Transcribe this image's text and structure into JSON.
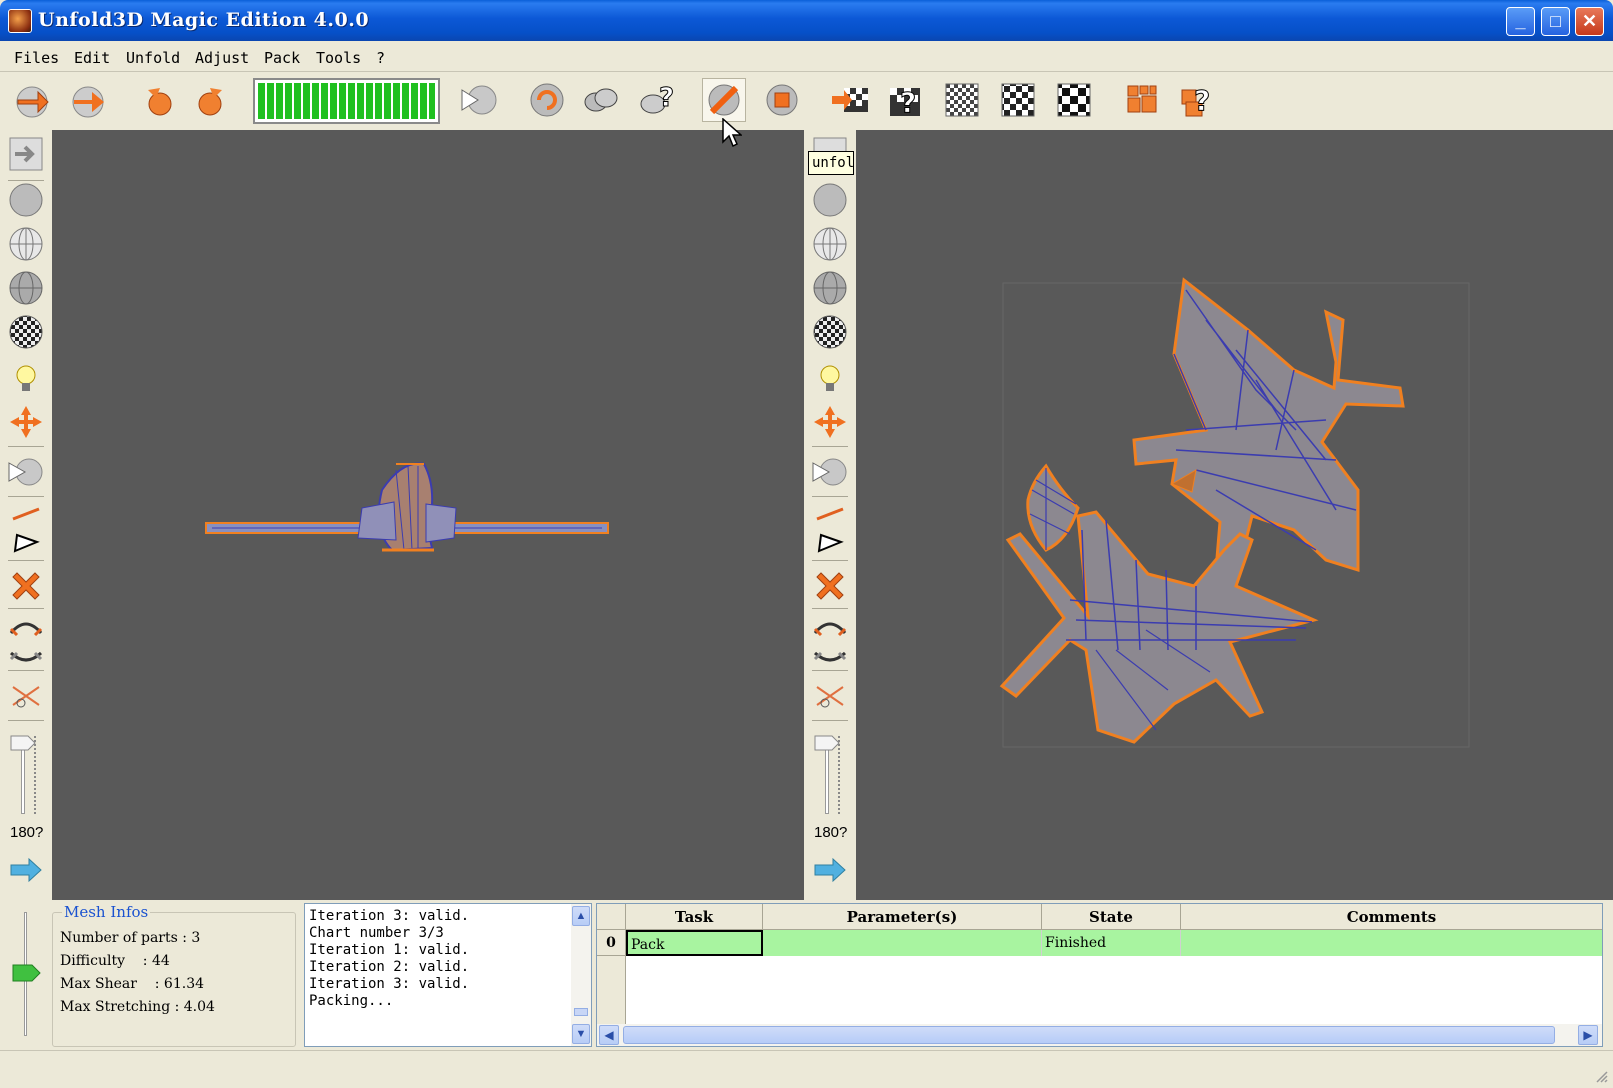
{
  "window": {
    "title": "Unfold3D Magic Edition 4.0.0",
    "minimize": "_",
    "maximize": "□",
    "close": "✕"
  },
  "menu": [
    "Files",
    "Edit",
    "Unfold",
    "Adjust",
    "Pack",
    "Tools",
    "?"
  ],
  "toolbar": {
    "progress_percent": 100,
    "icons": [
      "undo-icon",
      "redo-icon",
      "rotate-left-icon",
      "rotate-right-icon",
      "select-icon",
      "refresh-icon",
      "cut-icon",
      "help-icon",
      "unfold-icon",
      "stop-icon",
      "checker-icon",
      "pack-icon"
    ]
  },
  "left_panel": {
    "angle_label": "180?"
  },
  "right_panel": {
    "angle_label": "180?",
    "tooltip": "unfol"
  },
  "mesh_infos": {
    "title": "Mesh Infos",
    "lines": [
      "Number of parts : 3",
      "Difficulty    : 44",
      "Max Shear    : 61.34",
      "Max Stretching : 4.04"
    ]
  },
  "log": [
    "Iteration 3: valid.",
    "Chart number 3/3",
    "Iteration 1: valid.",
    "Iteration 2: valid.",
    "Iteration 3: valid.",
    "Packing..."
  ],
  "task_table": {
    "headers": [
      "Task",
      "Parameter(s)",
      "State",
      "Comments"
    ],
    "rows": [
      {
        "index": "0",
        "task": "Pack",
        "params": "",
        "state": "Finished",
        "comments": ""
      }
    ]
  },
  "colors": {
    "viewport": "#595959",
    "wire": "#3b3cb0",
    "edge": "#f08020",
    "row_highlight": "#a8f4a0"
  }
}
